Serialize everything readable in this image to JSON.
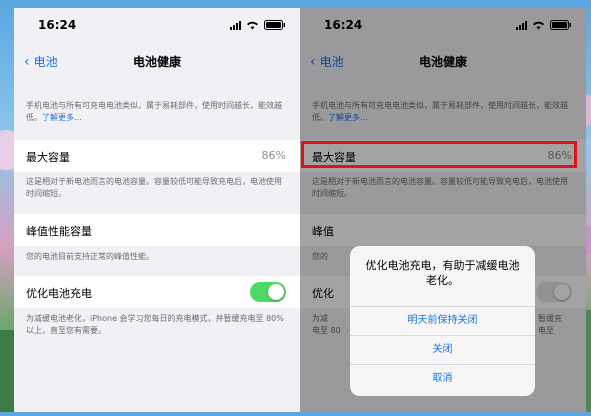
{
  "status": {
    "time": "16:24"
  },
  "nav": {
    "back_label": "电池",
    "title": "电池健康"
  },
  "intro": {
    "text": "手机电池与所有可充电电池类似，属于易耗部件，使用时间越长，能效越低。",
    "link": "了解更多…"
  },
  "max_capacity": {
    "label": "最大容量",
    "value": "86%",
    "desc": "这是相对于新电池而言的电池容量。容量较低可能导致充电后，电池使用时间缩短。"
  },
  "peak": {
    "label": "峰值性能容量",
    "desc": "您的电池目前支持正常的峰值性能。"
  },
  "optimized": {
    "label": "优化电池充电",
    "enabled": true,
    "desc": "为减缓电池老化，iPhone 会学习您每日的充电模式，并暂缓充电至 80% 以上，直至您有需要。"
  },
  "right": {
    "peak_label_partial": "峰值",
    "peak_desc_partial": "您的",
    "optimized_label_partial": "优化",
    "optimized_desc_a": "为减",
    "optimized_desc_b": "电至 80",
    "optimized_desc_tail_a": "暂缓充",
    "optimized_desc_tail_b": "电至"
  },
  "sheet": {
    "message": "优化电池充电，有助于减缓电池老化。",
    "option1": "明天前保持关闭",
    "option2": "关闭",
    "cancel": "取消"
  },
  "colors": {
    "accent": "#1a73e8",
    "toggle_on": "#4cd964",
    "highlight": "#e1121b"
  }
}
